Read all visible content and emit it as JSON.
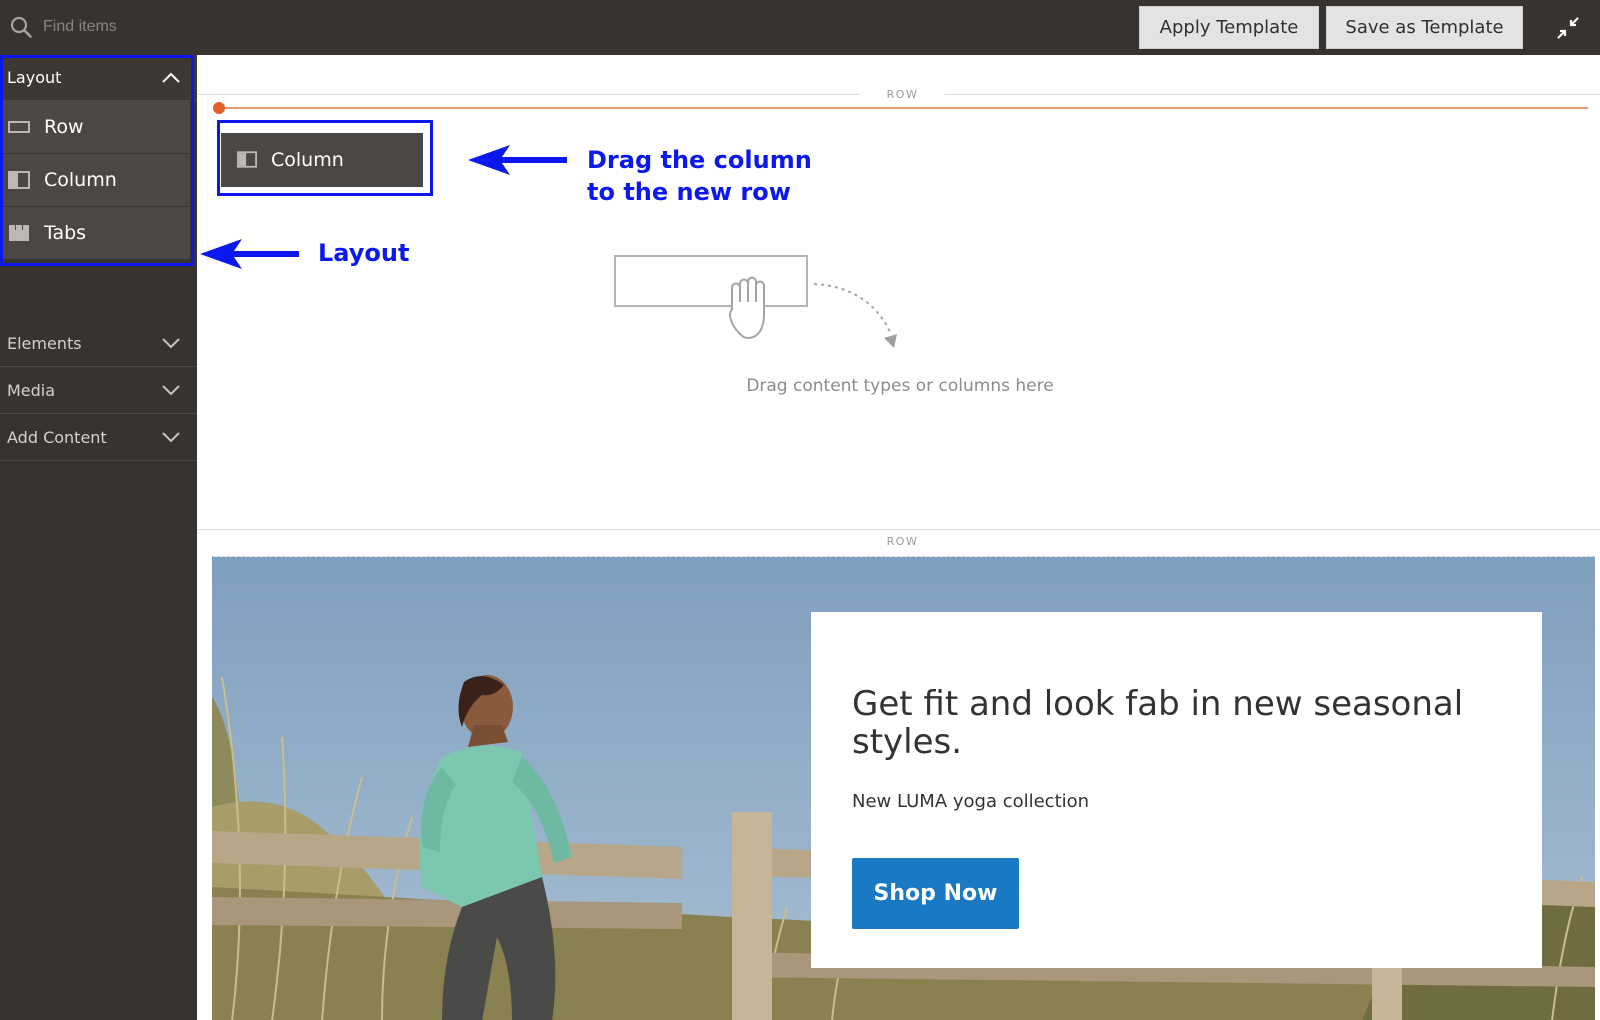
{
  "topbar": {
    "search_placeholder": "Find items",
    "apply_template_label": "Apply Template",
    "save_template_label": "Save as Template",
    "fullscreen_icon": "collapse-fullscreen-icon"
  },
  "sidebar": {
    "layout": {
      "label": "Layout",
      "expanded": true,
      "items": [
        {
          "label": "Row",
          "icon": "row-icon"
        },
        {
          "label": "Column",
          "icon": "column-icon"
        },
        {
          "label": "Tabs",
          "icon": "tabs-icon"
        }
      ]
    },
    "sections": [
      {
        "label": "Elements",
        "expanded": false
      },
      {
        "label": "Media",
        "expanded": false
      },
      {
        "label": "Add Content",
        "expanded": false
      }
    ]
  },
  "stage": {
    "row_label": "ROW",
    "dragging_item": {
      "label": "Column",
      "icon": "column-icon"
    },
    "empty_text": "Drag content types or columns here"
  },
  "annotations": {
    "drag_line1": "Drag the column",
    "drag_line2": "to the new row",
    "layout": "Layout",
    "color": "#0b18ef"
  },
  "banner": {
    "title": "Get fit and look fab in new seasonal styles.",
    "subtitle": "New LUMA yoga collection",
    "button_label": "Shop Now",
    "button_color": "#1979c3"
  },
  "colors": {
    "topbar": "#373330",
    "sidebar": "#363330",
    "sidebar_item": "#4a4744",
    "drop_indicator": "#e3622a"
  }
}
